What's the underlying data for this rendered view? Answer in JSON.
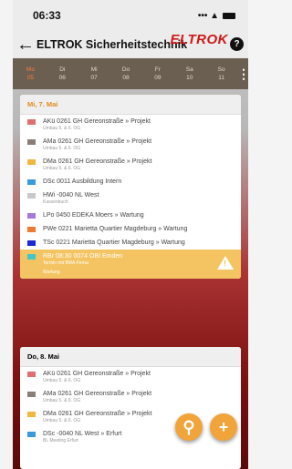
{
  "status": {
    "time": "06:33",
    "signal": "••• ▲"
  },
  "appbar": {
    "title": "ELTROK Sicherheitstechnik",
    "logo": "ELTROK"
  },
  "week": [
    {
      "name": "Mo",
      "date": "05",
      "active": true
    },
    {
      "name": "Di",
      "date": "06",
      "active": false
    },
    {
      "name": "Mi",
      "date": "07",
      "active": false
    },
    {
      "name": "Do",
      "date": "08",
      "active": false
    },
    {
      "name": "Fr",
      "date": "09",
      "active": false
    },
    {
      "name": "Sa",
      "date": "10",
      "active": false
    },
    {
      "name": "So",
      "date": "11",
      "active": false
    }
  ],
  "day1": {
    "header": "Mi, 7. Mai",
    "entries": [
      {
        "title": "AKü 0261 GH Gereonstraße » Projekt",
        "sub": "Umbau 5. & 6. OG",
        "color": "#e07070"
      },
      {
        "title": "AMa 0261 GH Gereonstraße » Projekt",
        "sub": "Umbau 5. & 6. OG",
        "color": "#8a7e78"
      },
      {
        "title": "DMa 0261 GH Gereonstraße » Projekt",
        "sub": "Umbau 5. & 6. OG",
        "color": "#f0b840"
      },
      {
        "title": "DSc 0011 Ausbildung Intern",
        "sub": "",
        "color": "#3a9ae0"
      },
      {
        "title": "HWi -0040 NL West",
        "sub": "Kassenbuch",
        "color": "#c8c8c8"
      },
      {
        "title": "LPo 0450 EDEKA Moers » Wartung",
        "sub": "",
        "color": "#a878d8"
      },
      {
        "title": "PWe 0221 Marietta Quartier Magdeburg » Wartung",
        "sub": "",
        "color": "#f07a30"
      },
      {
        "title": "TSc 0221 Marietta Quartier Magdeburg » Wartung",
        "sub": "",
        "color": "#1a2ad8"
      },
      {
        "title": "RBr 08:30 0074 OBI Emden",
        "sub": "Termin mit BMA-Firma",
        "sub2": "Wartung",
        "color": "#40c8c8"
      }
    ]
  },
  "day2": {
    "header": "Do, 8. Mai",
    "entries": [
      {
        "title": "AKü 0261 GH Gereonstraße » Projekt",
        "sub": "Umbau 5. & 6. OG",
        "color": "#e07070"
      },
      {
        "title": "AMa 0261 GH Gereonstraße » Projekt",
        "sub": "Umbau 5. & 6. OG",
        "color": "#8a7e78"
      },
      {
        "title": "DMa 0261 GH Gereonstraße » Projekt",
        "sub": "Umbau 5. & 6. OG",
        "color": "#f0b840"
      },
      {
        "title": "DSc -0040 NL West » Erfurt",
        "sub": "BL Meeting Erfurt",
        "color": "#3a9ae0"
      }
    ]
  },
  "icons": {
    "back": "arrow-left-icon",
    "help": "question-icon",
    "search": "search-icon",
    "add": "plus-icon",
    "warning": "warning-icon",
    "more": "more-vertical-icon"
  },
  "glyphs": {
    "back": "←",
    "help": "?",
    "more": "⋮",
    "search": "⚲",
    "add": "+",
    "warning": "!"
  }
}
